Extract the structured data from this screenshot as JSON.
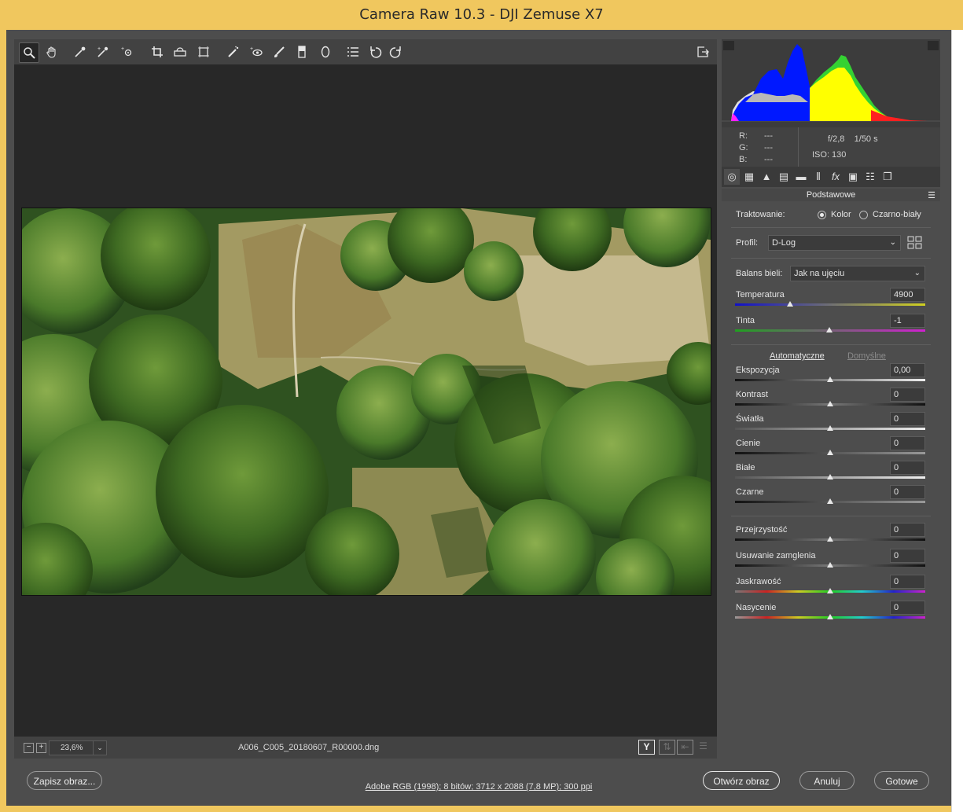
{
  "window": {
    "title": "Camera Raw 10.3  -  DJI Zemuse X7"
  },
  "toolbar": {
    "tools": [
      "zoom-tool",
      "hand-tool",
      "white-balance-tool",
      "color-sampler-tool",
      "targeted-adjustment-tool",
      "crop-tool",
      "straighten-tool",
      "transform-tool",
      "spot-removal-tool",
      "red-eye-tool",
      "adjustment-brush",
      "graduated-filter",
      "radial-filter",
      "preferences",
      "rotate-ccw",
      "rotate-cw"
    ],
    "active": "zoom-tool"
  },
  "status": {
    "zoom": "23,6%",
    "filename": "A006_C005_20180607_R00000.dng",
    "view_toggle": "Y"
  },
  "readout": {
    "r_label": "R:",
    "g_label": "G:",
    "b_label": "B:",
    "r": "---",
    "g": "---",
    "b": "---",
    "aperture": "f/2,8",
    "shutter": "1/50 s",
    "iso": "ISO: 130"
  },
  "panel": {
    "title": "Podstawowe",
    "treatment_label": "Traktowanie:",
    "treatment_color": "Kolor",
    "treatment_bw": "Czarno-biały",
    "treatment_selected": "Kolor",
    "profile_label": "Profil:",
    "profile_value": "D-Log",
    "wb_label": "Balans bieli:",
    "wb_value": "Jak na ujęciu",
    "auto_link": "Automatyczne",
    "default_link": "Domyślne",
    "sliders": [
      {
        "label": "Temperatura",
        "value": "4900",
        "pos": 0.29
      },
      {
        "label": "Tinta",
        "value": "-1",
        "pos": 0.495
      },
      {
        "label": "Ekspozycja",
        "value": "0,00",
        "pos": 0.5
      },
      {
        "label": "Kontrast",
        "value": "0",
        "pos": 0.5
      },
      {
        "label": "Światła",
        "value": "0",
        "pos": 0.5
      },
      {
        "label": "Cienie",
        "value": "0",
        "pos": 0.5
      },
      {
        "label": "Białe",
        "value": "0",
        "pos": 0.5
      },
      {
        "label": "Czarne",
        "value": "0",
        "pos": 0.5
      },
      {
        "label": "Przejrzystość",
        "value": "0",
        "pos": 0.5
      },
      {
        "label": "Usuwanie zamglenia",
        "value": "0",
        "pos": 0.5
      },
      {
        "label": "Jaskrawość",
        "value": "0",
        "pos": 0.5
      },
      {
        "label": "Nasycenie",
        "value": "0",
        "pos": 0.5
      }
    ]
  },
  "footer": {
    "save": "Zapisz obraz...",
    "workflow": "Adobe RGB (1998); 8 bitów; 3712 x 2088 (7,8 MP); 300 ppi",
    "open": "Otwórz obraz",
    "cancel": "Anuluj",
    "done": "Gotowe"
  },
  "colors": {
    "accent": "#f0c75e",
    "panel": "#4d4d4d",
    "canvas": "#282828"
  }
}
